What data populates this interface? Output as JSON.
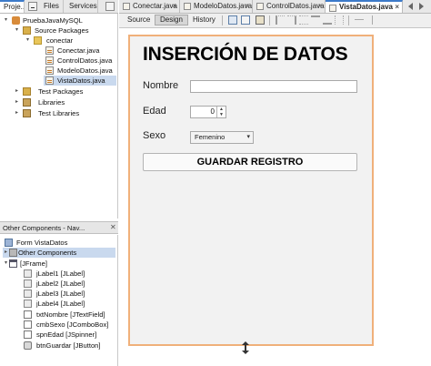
{
  "left_panel": {
    "tabs": [
      {
        "label": "Proje...",
        "active": true
      },
      {
        "label": "Files",
        "active": false
      },
      {
        "label": "Services",
        "active": false
      }
    ],
    "tree": [
      {
        "label": "PruebaJavaMySQL",
        "icon": "project-icon",
        "twisty": "▾"
      },
      {
        "label": "Source Packages",
        "icon": "source-packages-icon",
        "twisty": "▾"
      },
      {
        "label": "conectar",
        "icon": "package-icon",
        "twisty": "▾"
      },
      {
        "label": "Conectar.java",
        "icon": "java-file-icon",
        "twisty": ""
      },
      {
        "label": "ControlDatos.java",
        "icon": "java-file-icon",
        "twisty": ""
      },
      {
        "label": "ModeloDatos.java",
        "icon": "java-file-icon",
        "twisty": ""
      },
      {
        "label": "VistaDatos.java",
        "icon": "java-file-icon",
        "twisty": "",
        "selected": true
      },
      {
        "label": "Test Packages",
        "icon": "test-packages-icon",
        "twisty": "▸"
      },
      {
        "label": "Libraries",
        "icon": "libraries-icon",
        "twisty": "▸"
      },
      {
        "label": "Test Libraries",
        "icon": "test-libraries-icon",
        "twisty": "▸"
      }
    ]
  },
  "navigator": {
    "title": "Other Components - Nav...",
    "close_glyph": "✕",
    "form_label": "Form VistaDatos",
    "tree": [
      {
        "label": "Other Components",
        "icon": "other-components-icon",
        "twisty": "▸",
        "selected": true
      },
      {
        "label": "[JFrame]",
        "icon": "jframe-icon",
        "twisty": "▾"
      },
      {
        "label": "jLabel1 [JLabel]",
        "icon": "jlabel-icon",
        "twisty": ""
      },
      {
        "label": "jLabel2 [JLabel]",
        "icon": "jlabel-icon",
        "twisty": ""
      },
      {
        "label": "jLabel3 [JLabel]",
        "icon": "jlabel-icon",
        "twisty": ""
      },
      {
        "label": "jLabel4 [JLabel]",
        "icon": "jlabel-icon",
        "twisty": ""
      },
      {
        "label": "txtNombre [JTextField]",
        "icon": "jtextfield-icon",
        "twisty": ""
      },
      {
        "label": "cmbSexo [JComboBox]",
        "icon": "jcombobox-icon",
        "twisty": ""
      },
      {
        "label": "spnEdad [JSpinner]",
        "icon": "jspinner-icon",
        "twisty": ""
      },
      {
        "label": "btnGuardar [JButton]",
        "icon": "jbutton-icon",
        "twisty": ""
      }
    ]
  },
  "editor": {
    "tabs": [
      {
        "label": "Conectar.java",
        "active": false
      },
      {
        "label": "ModeloDatos.java",
        "active": false
      },
      {
        "label": "ControlDatos.java",
        "active": false
      },
      {
        "label": "VistaDatos.java",
        "active": true
      }
    ],
    "close_glyph": "×",
    "modes": [
      {
        "label": "Source",
        "active": false
      },
      {
        "label": "Design",
        "active": true
      },
      {
        "label": "History",
        "active": false
      }
    ]
  },
  "form": {
    "title": "INSERCIÓN DE DATOS",
    "nombre_label": "Nombre",
    "nombre_value": "",
    "edad_label": "Edad",
    "edad_value": "0",
    "sexo_label": "Sexo",
    "sexo_value": "Femenino",
    "guardar_label": "GUARDAR REGISTRO"
  },
  "colors": {
    "accent": "#3d7ac9",
    "design_border": "#f0b07a",
    "selection": "#c9d9ee"
  }
}
